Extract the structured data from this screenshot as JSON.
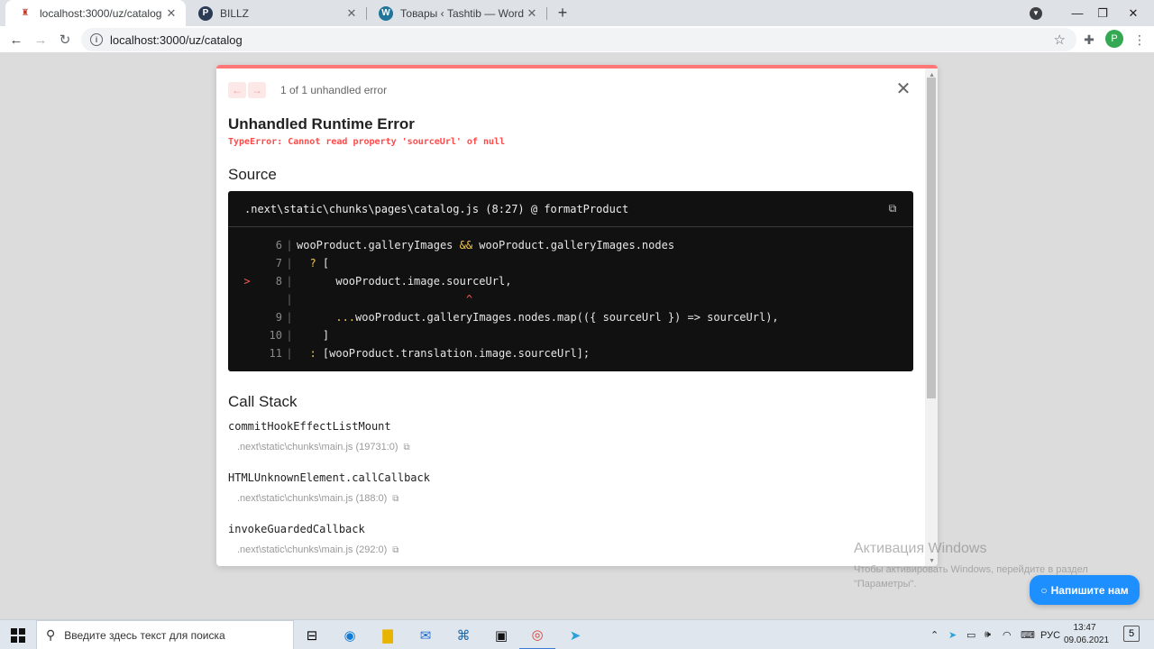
{
  "browser": {
    "tabs": [
      {
        "title": "localhost:3000/uz/catalog",
        "favicon": "localhost-icon",
        "active": true
      },
      {
        "title": "BILLZ",
        "favicon": "billz-icon",
        "active": false
      },
      {
        "title": "Товары ‹ Tashtib — WordPress",
        "favicon": "wordpress-icon",
        "active": false
      }
    ],
    "new_tab": "+",
    "url": "localhost:3000/uz/catalog",
    "profile_initial": "P"
  },
  "error_overlay": {
    "counter": "1 of 1 unhandled error",
    "title": "Unhandled Runtime Error",
    "message": "TypeError: Cannot read property 'sourceUrl' of null",
    "source_heading": "Source",
    "codeframe": {
      "file": ".next\\static\\chunks\\pages\\catalog.js (8:27) @ formatProduct",
      "lines": [
        {
          "marker": "",
          "num": "6",
          "code_a": "wooProduct.galleryImages ",
          "op": "&&",
          "code_b": " wooProduct.galleryImages.nodes"
        },
        {
          "marker": "",
          "num": "7",
          "code_a": "  ",
          "op": "?",
          "code_b": " ["
        },
        {
          "marker": ">",
          "num": "8",
          "code_a": "      wooProduct.image.sourceUrl,",
          "op": "",
          "code_b": ""
        },
        {
          "marker": "",
          "num": "",
          "code_a": "                          ",
          "op": "^",
          "code_b": "",
          "caret": true
        },
        {
          "marker": "",
          "num": "9",
          "code_a": "      ",
          "op": "...",
          "code_b": "wooProduct.galleryImages.nodes.map(({ sourceUrl }) => sourceUrl),"
        },
        {
          "marker": "",
          "num": "10",
          "code_a": "    ]",
          "op": "",
          "code_b": ""
        },
        {
          "marker": "",
          "num": "11",
          "code_a": "  ",
          "op": ":",
          "code_b": " [wooProduct.translation.image.sourceUrl];"
        }
      ]
    },
    "callstack_heading": "Call Stack",
    "callstack": [
      {
        "fn": "commitHookEffectListMount",
        "file": ".next\\static\\chunks\\main.js (19731:0)"
      },
      {
        "fn": "HTMLUnknownElement.callCallback",
        "file": ".next\\static\\chunks\\main.js (188:0)"
      },
      {
        "fn": "invokeGuardedCallback",
        "file": ".next\\static\\chunks\\main.js (292:0)"
      }
    ]
  },
  "watermark": {
    "title": "Активация Windows",
    "subtitle": "Чтобы активировать Windows, перейдите в раздел \"Параметры\"."
  },
  "chat_button": {
    "label": "Напишите нам"
  },
  "taskbar": {
    "search_placeholder": "Введите здесь текст для поиска",
    "lang": "РУС",
    "time": "13:47",
    "date": "09.06.2021",
    "notifications": "5"
  }
}
